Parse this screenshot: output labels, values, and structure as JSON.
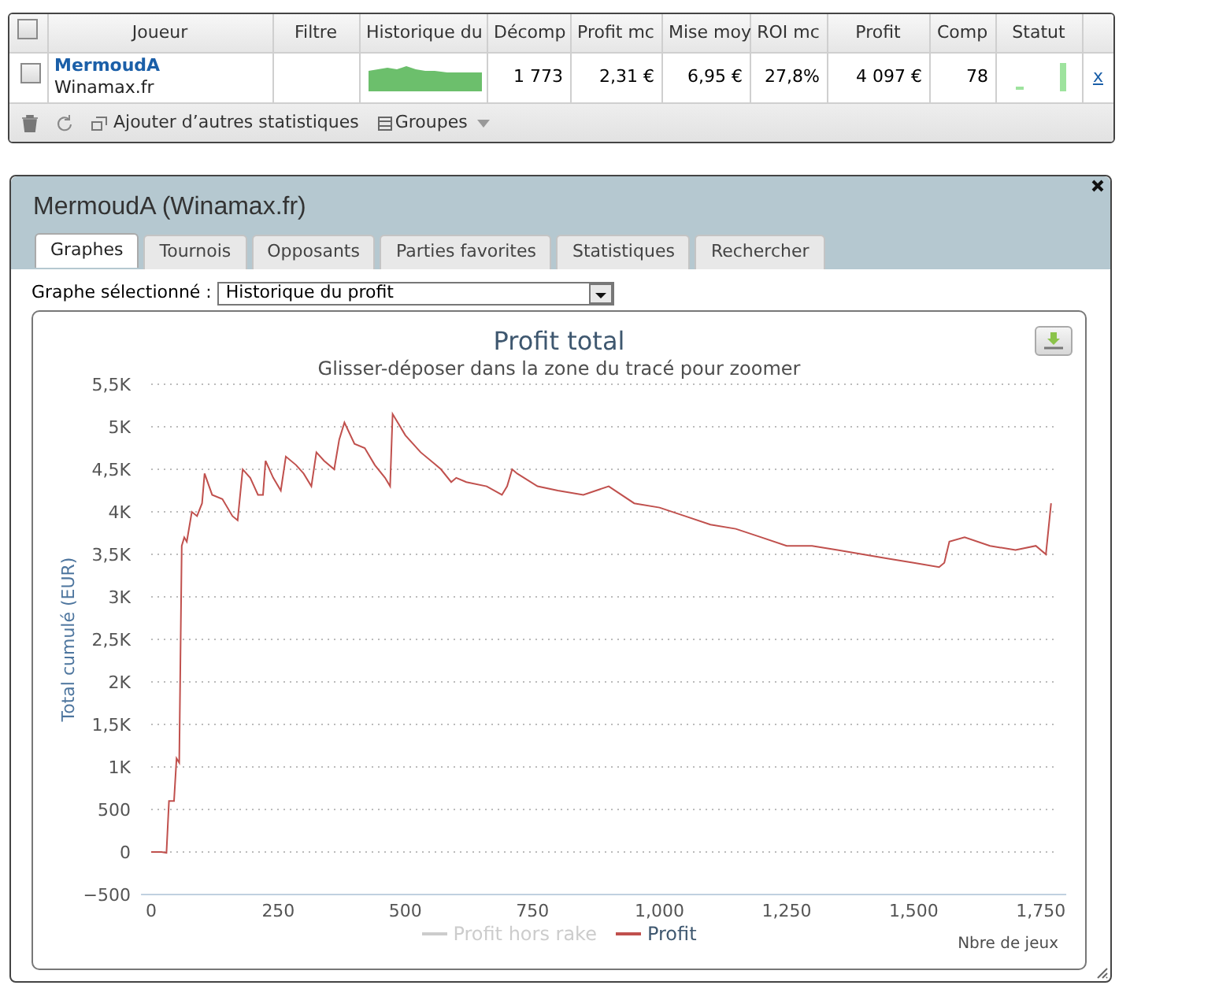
{
  "players_table": {
    "header_checkbox": {
      "checked": false
    },
    "columns": [
      "Joueur",
      "Filtre",
      "Historique du",
      "Décomp",
      "Profit mc",
      "Mise moy",
      "ROI mc",
      "Profit",
      "Comp",
      "Statut"
    ],
    "rows": [
      {
        "checked": false,
        "player": "MermoudA",
        "site": "Winamax.fr",
        "filter": "",
        "games": "1 773",
        "profit_mc": "2,31 €",
        "avg_stake": "6,95 €",
        "roi_mc": "27,8%",
        "profit": "4 097 €",
        "comp": "78",
        "remove": "x"
      }
    ],
    "toolbar": {
      "add_stats": "Ajouter d’autres statistiques",
      "groups": "Groupes"
    }
  },
  "player_panel": {
    "title": "MermoudA (Winamax.fr)",
    "tabs": [
      {
        "label": "Graphes",
        "selected": true
      },
      {
        "label": "Tournois",
        "selected": false
      },
      {
        "label": "Opposants",
        "selected": false
      },
      {
        "label": "Parties favorites",
        "selected": false
      },
      {
        "label": "Statistiques",
        "selected": false
      },
      {
        "label": "Rechercher",
        "selected": false
      }
    ],
    "graph_select": {
      "label": "Graphe sélectionné :",
      "value": "Historique du profit"
    },
    "chart": {
      "legend": [
        {
          "name": "Profit hors rake",
          "selected": false
        }
      ],
      "chart_data": {
        "type": "line",
        "title": "Profit total",
        "subtitle": "Glisser-déposer dans la zone du tracé pour zoomer",
        "xlabel": "Nbre de jeux",
        "ylabel": "Total cumulé (EUR)",
        "x": [
          0,
          20,
          30,
          35,
          45,
          50,
          55,
          60,
          65,
          70,
          80,
          90,
          100,
          105,
          120,
          140,
          160,
          170,
          180,
          195,
          210,
          220,
          225,
          240,
          255,
          265,
          285,
          300,
          315,
          325,
          340,
          360,
          370,
          380,
          400,
          420,
          440,
          460,
          470,
          475,
          500,
          530,
          560,
          570,
          590,
          600,
          620,
          660,
          690,
          700,
          710,
          720,
          760,
          800,
          850,
          900,
          950,
          1000,
          1050,
          1100,
          1150,
          1200,
          1250,
          1300,
          1350,
          1400,
          1450,
          1500,
          1550,
          1560,
          1570,
          1600,
          1650,
          1700,
          1740,
          1760,
          1770
        ],
        "series": [
          {
            "name": "Profit",
            "color": "#c0504d",
            "values": [
              0,
              0,
              -10,
              600,
              600,
              1100,
              1050,
              3600,
              3700,
              3650,
              4000,
              3950,
              4100,
              4450,
              4200,
              4150,
              3950,
              3900,
              4500,
              4400,
              4200,
              4200,
              4600,
              4400,
              4250,
              4650,
              4550,
              4450,
              4300,
              4700,
              4600,
              4500,
              4850,
              5050,
              4800,
              4750,
              4550,
              4400,
              4300,
              5150,
              4900,
              4700,
              4550,
              4500,
              4350,
              4400,
              4350,
              4300,
              4200,
              4300,
              4500,
              4450,
              4300,
              4250,
              4200,
              4300,
              4100,
              4050,
              3950,
              3850,
              3800,
              3700,
              3600,
              3600,
              3550,
              3500,
              3450,
              3400,
              3350,
              3400,
              3650,
              3700,
              3600,
              3550,
              3600,
              3500,
              4100
            ]
          }
        ],
        "xlim": [
          -20,
          1800
        ],
        "ylim": [
          -500,
          5500
        ],
        "grid": true,
        "xticks": [
          {
            "value": 0,
            "label": "0"
          },
          {
            "value": 250,
            "label": "250"
          },
          {
            "value": 500,
            "label": "500"
          },
          {
            "value": 750,
            "label": "750"
          },
          {
            "value": 1000,
            "label": "1,000"
          },
          {
            "value": 1250,
            "label": "1,250"
          },
          {
            "value": 1500,
            "label": "1,500"
          },
          {
            "value": 1750,
            "label": "1,750"
          }
        ],
        "yticks": [
          {
            "value": -500,
            "label": "−500"
          },
          {
            "value": 0,
            "label": "0"
          },
          {
            "value": 500,
            "label": "500"
          },
          {
            "value": 1000,
            "label": "1K"
          },
          {
            "value": 1500,
            "label": "1,5K"
          },
          {
            "value": 2000,
            "label": "2K"
          },
          {
            "value": 2500,
            "label": "2,5K"
          },
          {
            "value": 3000,
            "label": "3K"
          },
          {
            "value": 3500,
            "label": "3,5K"
          },
          {
            "value": 4000,
            "label": "4K"
          },
          {
            "value": 4500,
            "label": "4,5K"
          },
          {
            "value": 5000,
            "label": "5K"
          },
          {
            "value": 5500,
            "label": "5,5K"
          }
        ]
      }
    }
  }
}
